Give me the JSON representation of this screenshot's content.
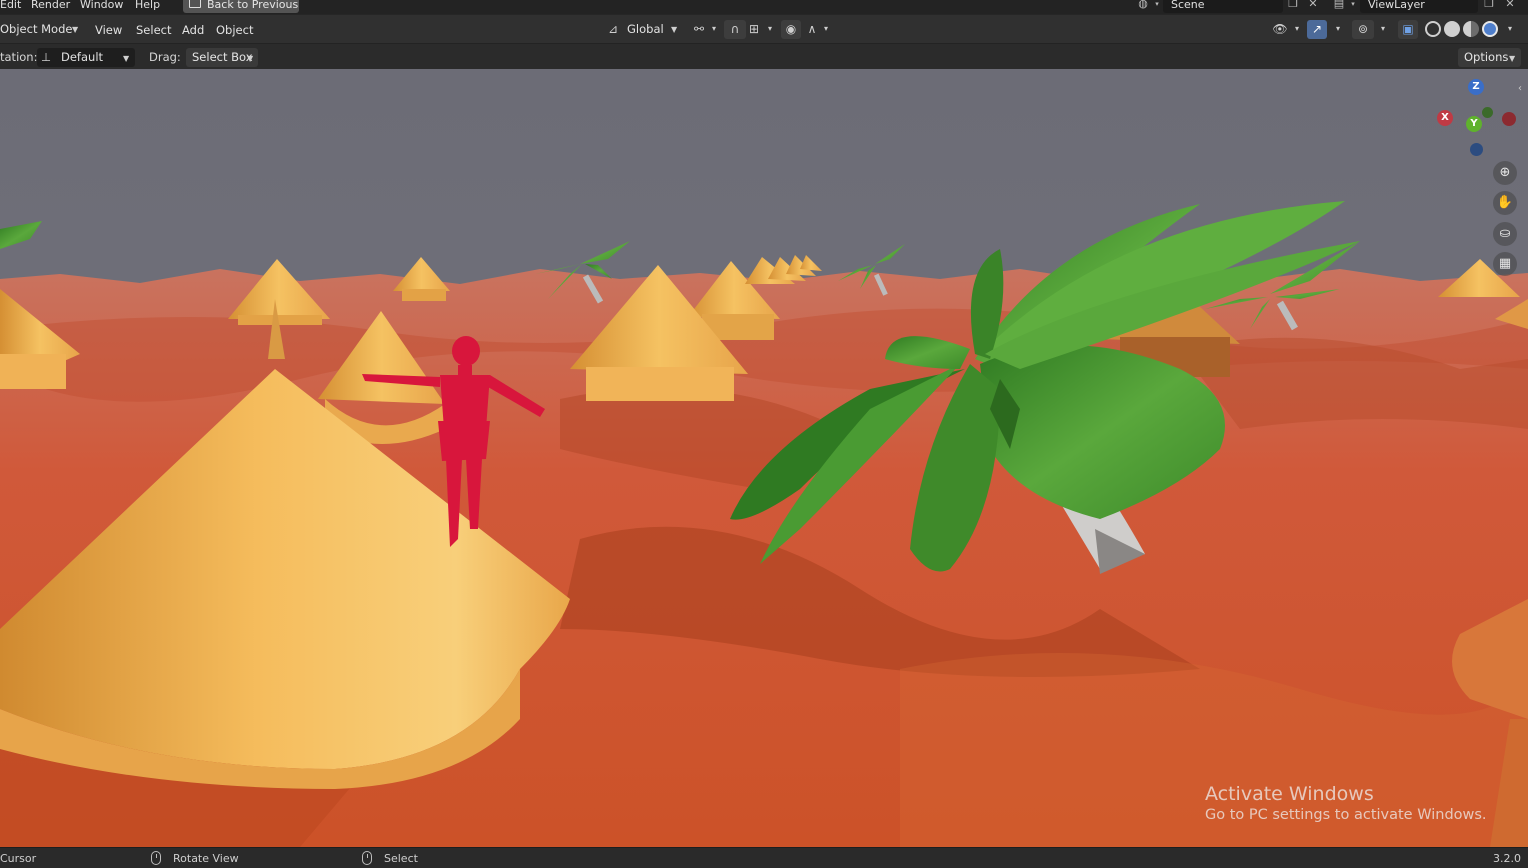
{
  "menu": {
    "items": [
      "Edit",
      "Render",
      "Window",
      "Help"
    ],
    "back_button": "Back to Previous",
    "scene": "Scene",
    "view_layer": "ViewLayer"
  },
  "header": {
    "mode": "Object Mode",
    "menus": [
      "View",
      "Select",
      "Add",
      "Object"
    ],
    "transform_orientation": "Global"
  },
  "tool_settings": {
    "orientation_label": "tation:",
    "orientation_value": "Default",
    "drag_label": "Drag:",
    "drag_value": "Select Box",
    "options_label": "Options"
  },
  "gizmo": {
    "z": "Z",
    "y": "Y",
    "x": "X"
  },
  "nav_icons": [
    "zoom-icon",
    "pan-hand-icon",
    "camera-icon",
    "grid-perspective-icon"
  ],
  "watermark": {
    "title": "Activate Windows",
    "subtitle": "Go to PC settings to activate Windows."
  },
  "status": {
    "left": "Cursor",
    "rotate": "Rotate View",
    "select": "Select",
    "version": "3.2.0"
  },
  "colors": {
    "sky": "#6e6e78",
    "sand": "#d4603c",
    "hut": "#f2b65a",
    "leaf": "#4c9a34",
    "figure": "#d8163c"
  }
}
